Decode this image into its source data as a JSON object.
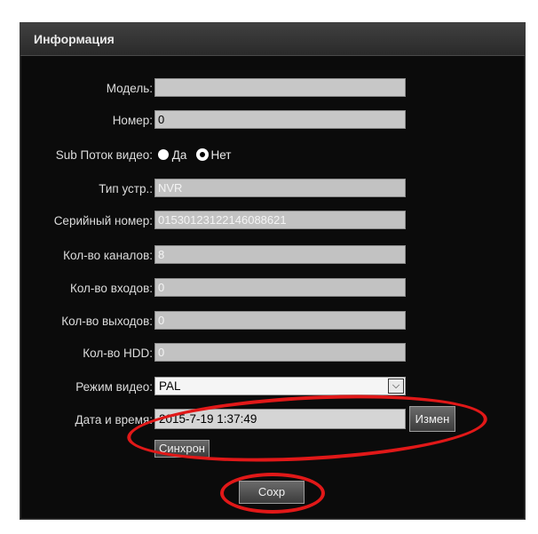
{
  "panel": {
    "title": "Информация"
  },
  "labels": {
    "model": "Модель:",
    "number": "Номер:",
    "substream": "Sub Поток видео:",
    "device_type": "Тип устр.:",
    "serial": "Серийный номер:",
    "channels": "Кол-во каналов:",
    "inputs": "Кол-во входов:",
    "outputs": "Кол-во выходов:",
    "hdd": "Кол-во HDD:",
    "video_mode": "Режим видео:",
    "datetime": "Дата и время:"
  },
  "fields": {
    "model": "",
    "number": "0",
    "device_type": "NVR",
    "serial": "01530123122146088621",
    "channels": "8",
    "inputs": "0",
    "outputs": "0",
    "hdd": "0",
    "video_mode": "PAL",
    "datetime": "2015-7-19 1:37:49"
  },
  "radio": {
    "yes": "Да",
    "no": "Нет",
    "selected": "no"
  },
  "buttons": {
    "change": "Измен",
    "sync": "Синхрон",
    "save": "Сохр"
  },
  "icons": {
    "dropdown": "chevron-down-icon"
  },
  "colors": {
    "highlight": "#e11818"
  }
}
